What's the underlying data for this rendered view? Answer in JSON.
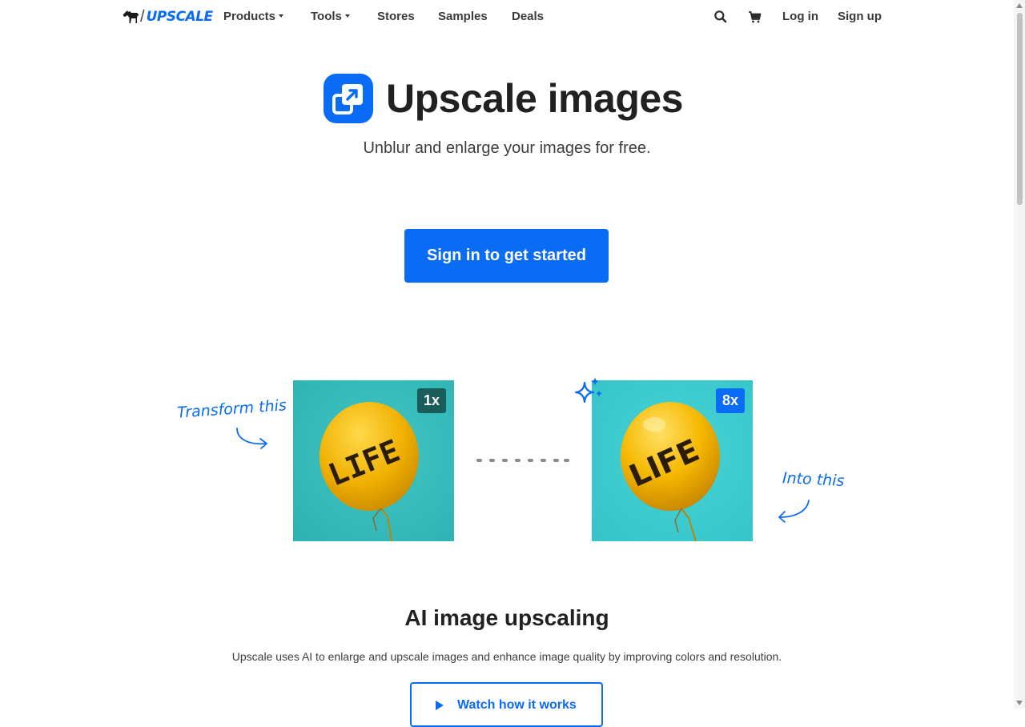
{
  "nav": {
    "logo_text": "UPSCALE",
    "items": [
      {
        "label": "Products",
        "dropdown": true
      },
      {
        "label": "Tools",
        "dropdown": true
      },
      {
        "label": "Stores",
        "dropdown": false
      },
      {
        "label": "Samples",
        "dropdown": false
      },
      {
        "label": "Deals",
        "dropdown": false
      }
    ],
    "icons": [
      "search-icon",
      "cart-icon"
    ],
    "login_label": "Log in",
    "signup_label": "Sign up"
  },
  "hero": {
    "icon": "upscale-app-icon",
    "title": "Upscale images",
    "subtitle": "Unblur and enlarge your images for free.",
    "cta_label": "Sign in to get started"
  },
  "comparison": {
    "left_note": "Transform this",
    "right_note": "Into this",
    "before_badge": "1x",
    "after_badge": "8x",
    "balloon_text": "LIFE",
    "sparkle_icon": "sparkle-icon"
  },
  "section": {
    "title": "AI image upscaling",
    "text": "Upscale uses AI to enlarge and upscale images and enhance image quality by improving colors and resolution.",
    "watch_label": "Watch how it works"
  },
  "colors": {
    "brand": "#0a6cf5",
    "badge_before": "#1a5c5a",
    "badge_after": "#0a6cf5",
    "image_background": "#3ec4c8",
    "balloon": "#f2b705"
  }
}
